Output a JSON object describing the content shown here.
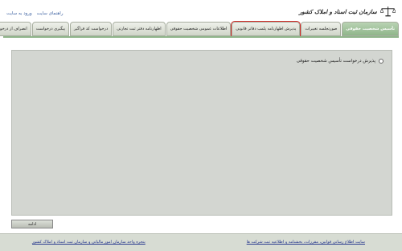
{
  "header": {
    "links": [
      "ورود به سایت",
      "راهنمای سایت"
    ],
    "logo_text": "سازمان ثبت اسناد و املاک کشور"
  },
  "tabs": [
    {
      "label": "تأسیس شخصیت حقوقی",
      "active": true
    },
    {
      "label": "صورتجلسه تغییرات"
    },
    {
      "label": "پذیرش اظهارنامه پلمب دفاتر قانونی",
      "highlight": true
    },
    {
      "label": "اطلاعات عمومی شخصیت حقوقی"
    },
    {
      "label": "اظهارنامه دفتر ثبت تجارتی"
    },
    {
      "label": "درخواست کد فراگیر"
    },
    {
      "label": "پیگیری درخواست"
    },
    {
      "label": "انصراف از درخواست"
    }
  ],
  "panel": {
    "radio_label": "پذیرش درخواست تأسیس شخصیت حقوقی"
  },
  "actions": {
    "continue_label": "ادامه"
  },
  "footer": {
    "right_link": "سایت اطلاع رسانی قوانین، مقررات، بخشنامه و اطلاعیه ثبت شرکت ها",
    "left_link": "پنجره واحد سازمان امور مالیاتی و سازمان ثبت اسناد و املاک کشور"
  }
}
